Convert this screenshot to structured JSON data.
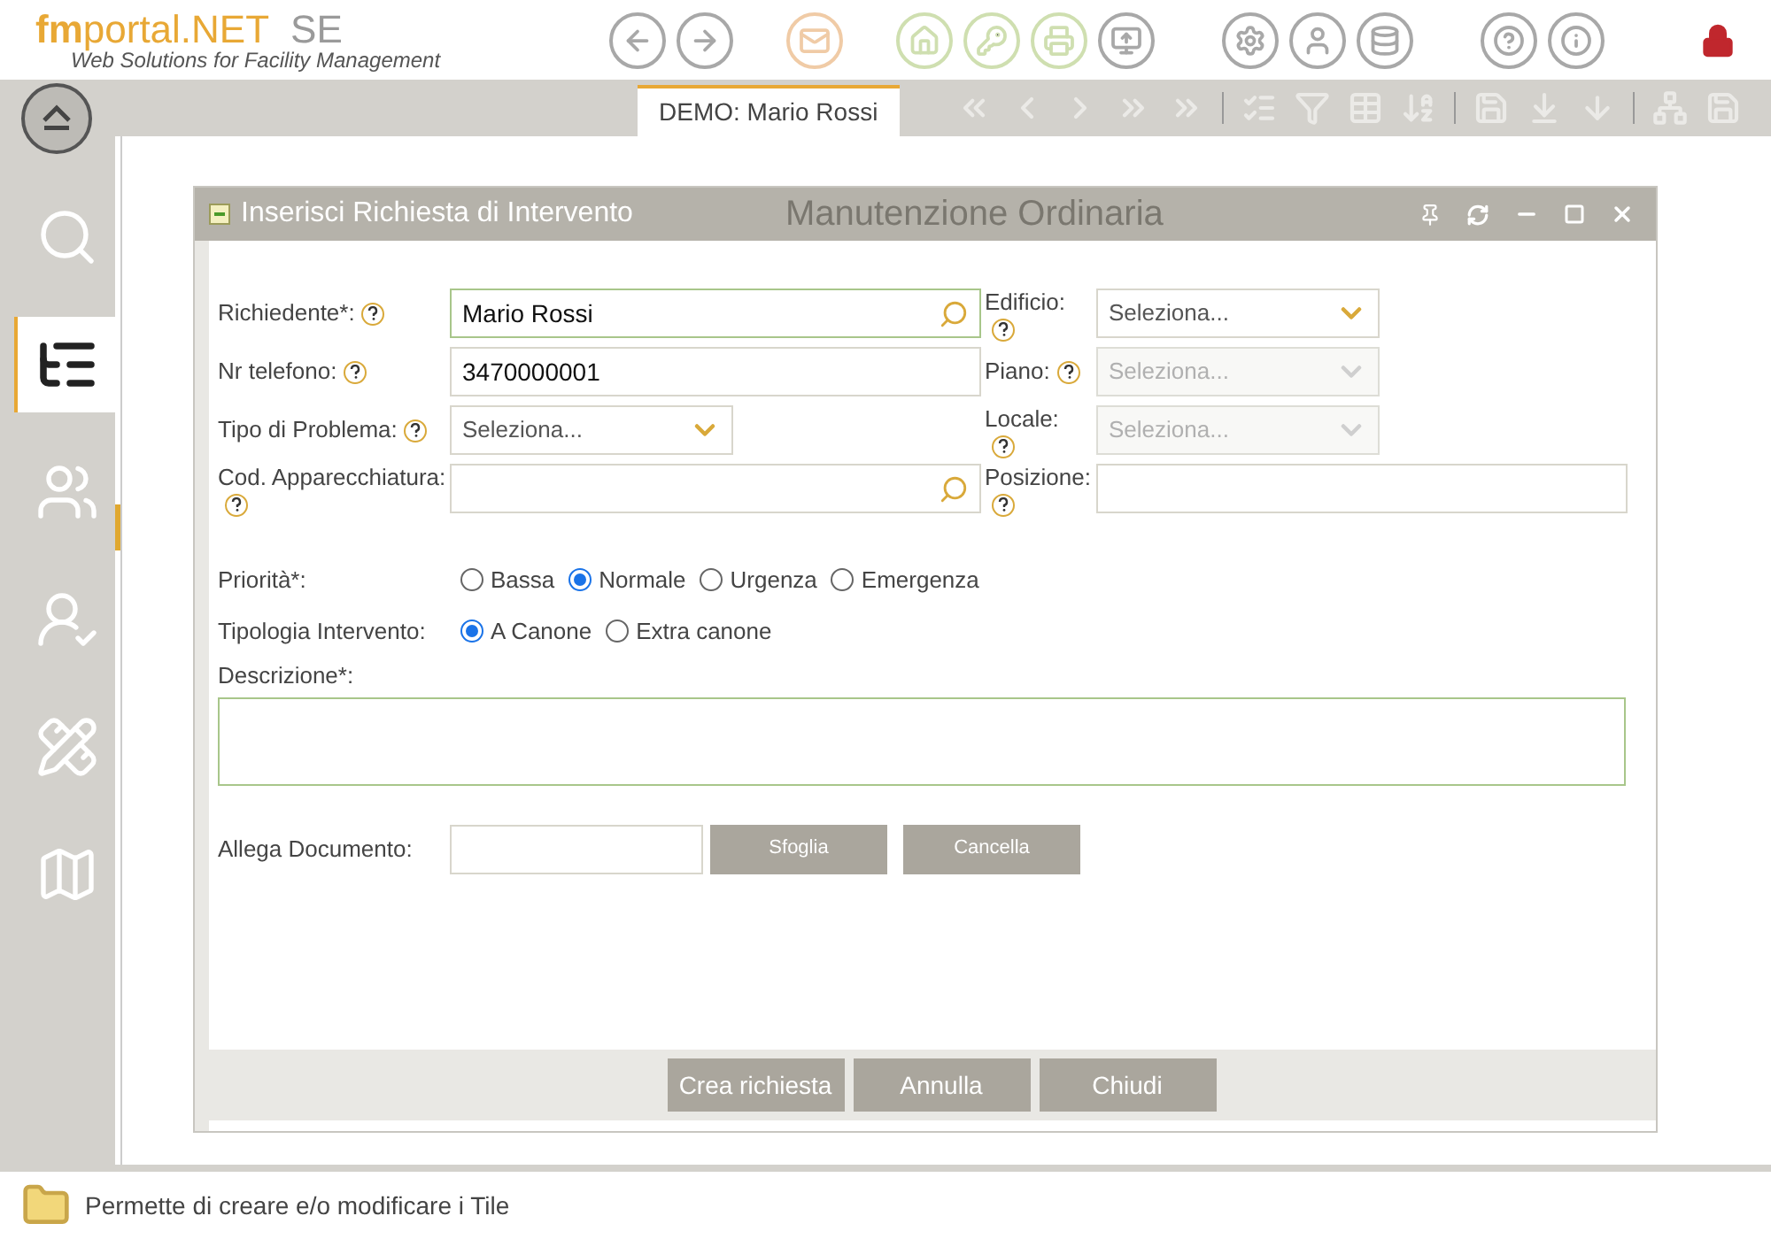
{
  "logo": {
    "brand_bold": "fm",
    "brand": "portal.NET",
    "edition": "SE",
    "tagline": "Web Solutions for Facility Management"
  },
  "header_icons": [
    {
      "kind": "back"
    },
    {
      "kind": "forward"
    },
    {
      "kind": "mail"
    },
    {
      "kind": "home"
    },
    {
      "kind": "key"
    },
    {
      "kind": "print"
    },
    {
      "kind": "export"
    },
    {
      "kind": "settings"
    },
    {
      "kind": "user"
    },
    {
      "kind": "database"
    },
    {
      "kind": "help"
    },
    {
      "kind": "info"
    },
    {
      "kind": "lock"
    }
  ],
  "tabs": [
    {
      "label": "DEMO: Mario Rossi",
      "selected": true
    }
  ],
  "toolbar_icons": [
    {
      "kind": "first"
    },
    {
      "kind": "prev"
    },
    {
      "kind": "next"
    },
    {
      "kind": "last"
    },
    {
      "kind": "goto"
    },
    {
      "kind": "sep"
    },
    {
      "kind": "check"
    },
    {
      "kind": "filter"
    },
    {
      "kind": "grid"
    },
    {
      "kind": "sort"
    },
    {
      "kind": "sep"
    },
    {
      "kind": "save"
    },
    {
      "kind": "download"
    },
    {
      "kind": "download2"
    },
    {
      "kind": "sep"
    },
    {
      "kind": "tree"
    },
    {
      "kind": "save"
    }
  ],
  "sidebar": {
    "items": [
      {
        "kind": "search",
        "selected": false
      },
      {
        "kind": "list",
        "selected": true
      },
      {
        "kind": "users",
        "selected": false
      },
      {
        "kind": "user-star",
        "selected": false
      },
      {
        "kind": "plan",
        "selected": false
      },
      {
        "kind": "map",
        "selected": false
      }
    ]
  },
  "background_heading": "Manutenzione Ordinaria",
  "dialog": {
    "title": "Inserisci Richiesta di Intervento",
    "left_fields": [
      {
        "label": "Richiedente*:",
        "kind": "lookup",
        "value": "Mario Rossi",
        "focused": true
      },
      {
        "label": "Nr telefono:",
        "kind": "text",
        "value": "3470000001",
        "focused": false
      },
      {
        "label": "Tipo di Problema:",
        "kind": "select",
        "placeholder": "Seleziona...",
        "disabled": false
      },
      {
        "label": "Cod. Apparecchiatura:",
        "kind": "lookup",
        "focused": false
      }
    ],
    "right_fields": [
      {
        "label": "Edificio:",
        "kind": "select",
        "placeholder": "Seleziona...",
        "disabled": false
      },
      {
        "label": "Piano:",
        "kind": "select",
        "placeholder": "Seleziona...",
        "disabled": true
      },
      {
        "label": "Locale:",
        "kind": "select",
        "placeholder": "Seleziona...",
        "disabled": true
      },
      {
        "label": "Posizione:",
        "kind": "text"
      }
    ],
    "priority": {
      "label": "Priorità*:",
      "options": [
        {
          "label": "Bassa",
          "selected": false
        },
        {
          "label": "Normale",
          "selected": true
        },
        {
          "label": "Urgenza",
          "selected": false
        },
        {
          "label": "Emergenza",
          "selected": false
        }
      ]
    },
    "intervention_type": {
      "label": "Tipologia Intervento:",
      "options": [
        {
          "label": "A Canone",
          "selected": true
        },
        {
          "label": "Extra canone",
          "selected": false
        }
      ]
    },
    "description": {
      "label": "Descrizione*:"
    },
    "attachment": {
      "label": "Allega Documento:",
      "buttons": [
        "Sfoglia",
        "Cancella"
      ]
    },
    "buttons": [
      "Crea richiesta",
      "Annulla",
      "Chiudi"
    ]
  },
  "status_bar": {
    "text": "Permette di creare e/o modificare i Tile"
  }
}
